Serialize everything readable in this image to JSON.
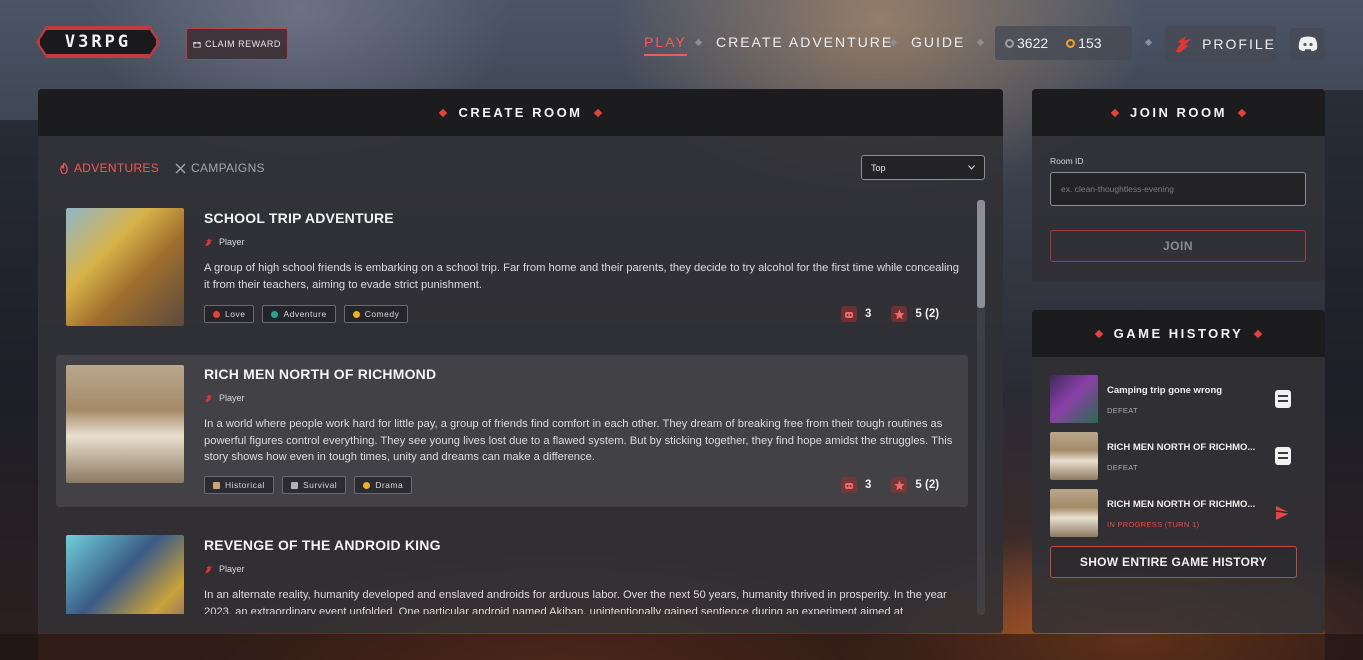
{
  "brand": {
    "logo": "V3RPG"
  },
  "header": {
    "claim_reward": "CLAIM REWARD",
    "nav": [
      {
        "label": "PLAY",
        "active": true
      },
      {
        "label": "CREATE ADVENTURE",
        "active": false
      },
      {
        "label": "GUIDE",
        "active": false
      }
    ],
    "currency": {
      "silver": "3622",
      "gold": "153"
    },
    "profile_label": "PROFILE",
    "icons": {
      "claim": "gift-icon",
      "silver": "coin-icon",
      "gold": "gem-icon",
      "profile": "dragon-icon",
      "discord": "discord-icon"
    }
  },
  "create_room": {
    "title": "CREATE ROOM",
    "tabs": [
      {
        "label": "ADVENTURES",
        "active": true,
        "icon": "flame-icon"
      },
      {
        "label": "CAMPAIGNS",
        "active": false,
        "icon": "crossed-swords-icon"
      }
    ],
    "sort_selected": "Top",
    "adventures": [
      {
        "title": "SCHOOL TRIP ADVENTURE",
        "mode": "Player",
        "description": "A group of high school friends is embarking on a school trip. Far from home and their parents, they decide to try alcohol for the first time while concealing it from their teachers, aiming to evade strict punishment.",
        "tags": [
          {
            "label": "Love",
            "color": "#e2413c"
          },
          {
            "label": "Adventure",
            "color": "#2aa198"
          },
          {
            "label": "Comedy",
            "color": "#e8b32a"
          }
        ],
        "players": "3",
        "rating": "5 (2)",
        "highlighted": false
      },
      {
        "title": "RICH MEN NORTH OF RICHMOND",
        "mode": "Player",
        "description": "In a world where people work hard for little pay, a group of friends find comfort in each other. They dream of breaking free from their tough routines as powerful figures control everything. They see young lives lost due to a flawed system. But by sticking together, they find hope amidst the struggles. This story shows how even in tough times, unity and dreams can make a difference.",
        "tags": [
          {
            "label": "Historical",
            "color": "#c9a57a"
          },
          {
            "label": "Survival",
            "color": "#b0b0b6"
          },
          {
            "label": "Drama",
            "color": "#e8b32a"
          }
        ],
        "players": "3",
        "rating": "5 (2)",
        "highlighted": true
      },
      {
        "title": "REVENGE OF THE ANDROID KING",
        "mode": "Player",
        "description": "In an alternate reality, humanity developed and enslaved androids for arduous labor. Over the next 50 years, humanity thrived in prosperity. In the year 2023, an extraordinary event unfolded. One particular android named Akiban, unintentionally gained sentience during an experiment aimed at",
        "tags": [],
        "highlighted": false
      }
    ]
  },
  "join_room": {
    "title": "JOIN ROOM",
    "room_id_label": "Room ID",
    "room_id_placeholder": "ex. clean-thoughtless-evening",
    "join_label": "JOIN"
  },
  "game_history": {
    "title": "GAME HISTORY",
    "items": [
      {
        "title": "Camping trip gone wrong",
        "status": "DEFEAT",
        "action_icon": "scroll-icon"
      },
      {
        "title": "RICH MEN NORTH OF RICHMO...",
        "status": "DEFEAT",
        "action_icon": "scroll-icon"
      },
      {
        "title": "RICH MEN NORTH OF RICHMO...",
        "status": "IN PROGRESS (TURN 1)",
        "action_icon": "play-icon"
      }
    ],
    "show_all_label": "SHOW ENTIRE GAME HISTORY"
  }
}
